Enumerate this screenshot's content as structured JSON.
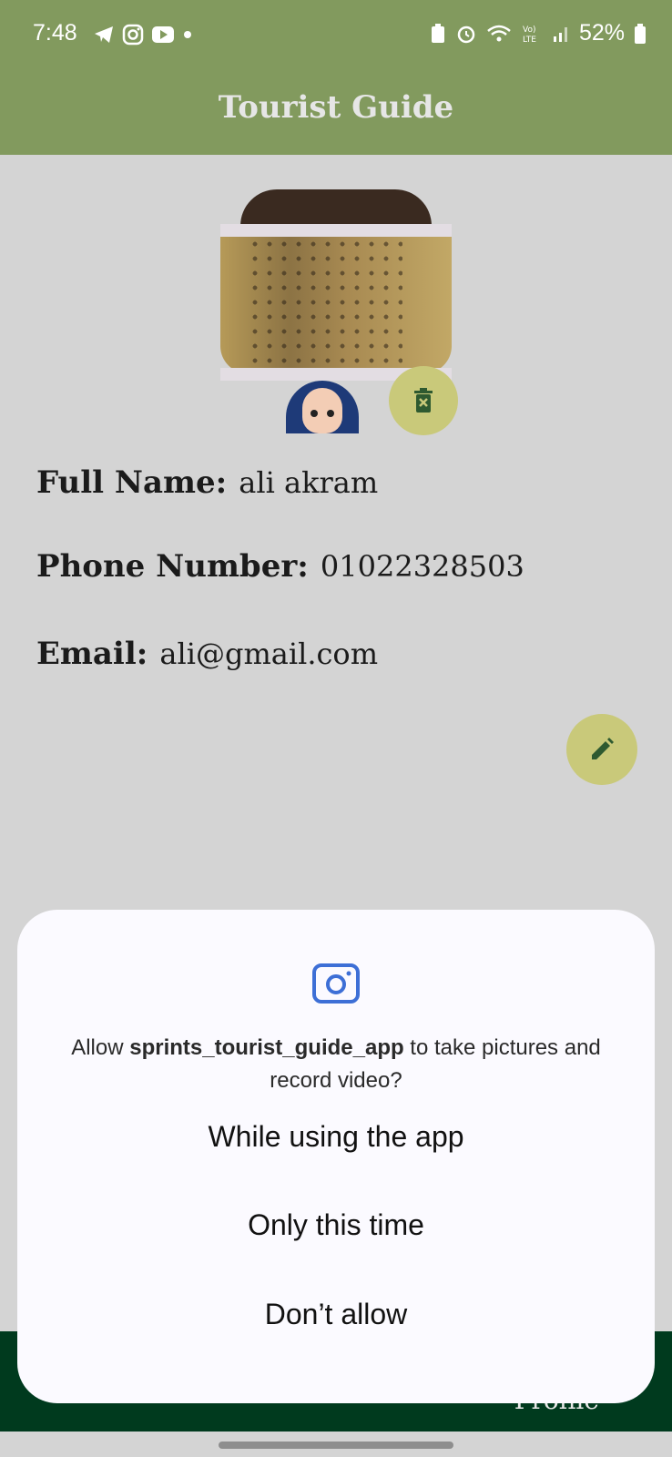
{
  "status_bar": {
    "time": "7:48",
    "left_icons": [
      "telegram-icon",
      "instagram-icon",
      "youtube-icon",
      "dot-icon"
    ],
    "right_icons": [
      "battery-saver-icon",
      "alarm-icon",
      "wifi-icon",
      "volte-icon",
      "signal-icon"
    ],
    "battery": "52%"
  },
  "app_bar": {
    "title": "Tourist Guide"
  },
  "profile": {
    "fields": [
      {
        "label": "Full Name:",
        "value": "ali akram"
      },
      {
        "label": "Phone Number:",
        "value": "01022328503"
      },
      {
        "label": "Email:",
        "value": "ali@gmail.com"
      }
    ]
  },
  "bottom_nav": {
    "visible_label": "Profile"
  },
  "dialog": {
    "icon": "camera-icon",
    "message_prefix": "Allow ",
    "app_name": "sprints_tourist_guide_app",
    "message_suffix": " to take pictures and record video?",
    "options": [
      "While using the app",
      "Only this time",
      "Don’t allow"
    ]
  },
  "colors": {
    "app_bar": "#829a5e",
    "background": "#d4d4d4",
    "fab": "#c9c97a",
    "bottom_nav": "#003a1e",
    "dialog_bg": "#fbfaff",
    "accent": "#3d6fd6"
  }
}
